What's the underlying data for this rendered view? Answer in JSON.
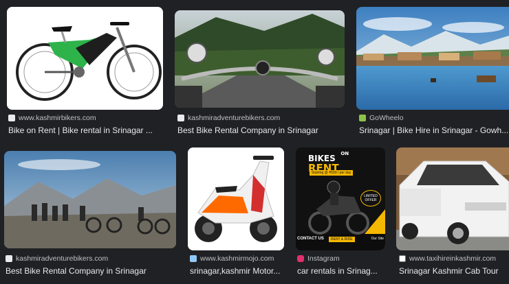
{
  "results": [
    {
      "source": "www.kashmirbikers.com",
      "title": "Bike on Rent | Bike rental in Srinagar ...",
      "favicon_color": "#e8eaed",
      "favicon": "globe-icon"
    },
    {
      "source": "kashmiradventurebikers.com",
      "title": "Best Bike Rental Company in Srinagar",
      "favicon_color": "#e8eaed",
      "favicon": "site-icon"
    },
    {
      "source": "GoWheelo",
      "title": "Srinagar | Bike Hire in Srinagar - Gowh...",
      "favicon_color": "#8bc34a",
      "favicon": "gowheelo-icon"
    },
    {
      "source": "kashmiradventurebikers.com",
      "title": "Best Bike Rental Company in Srinagar",
      "favicon_color": "#e8eaed",
      "favicon": "site-icon"
    },
    {
      "source": "www.kashmirmojo.com",
      "title": "srinagar,kashmir Motor...",
      "favicon_color": "#90caf9",
      "favicon": "mojo-icon"
    },
    {
      "source": "Instagram",
      "title": "car rentals in Srinag...",
      "favicon_color": "#e1306c",
      "favicon": "instagram-icon"
    },
    {
      "source": "www.taxihireinkashmir.com",
      "title": "Srinagar Kashmir Cab Tour",
      "favicon_color": "#ffffff",
      "favicon": "taxi-icon"
    }
  ],
  "poster": {
    "line1": "BIKES",
    "line2": "ON",
    "line3": "RENT",
    "starting": "Starting @ ₹599 / per day",
    "offer": "LIMITED OFFER",
    "contact": "CONTACT US",
    "cta": "RENT & RIDE",
    "sub": "Our Site"
  },
  "colors": {
    "background": "#202124",
    "title": "#e8eaed",
    "source": "#bdc1c6"
  }
}
